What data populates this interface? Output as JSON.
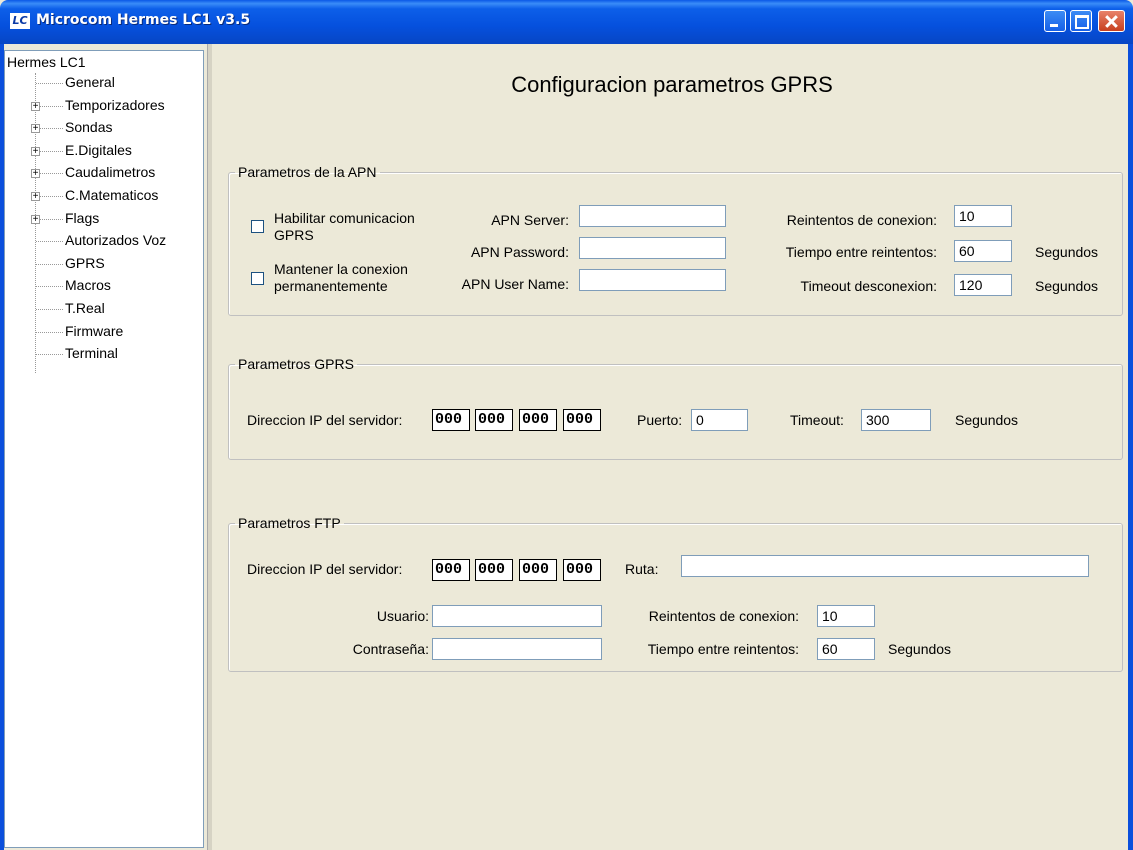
{
  "window": {
    "title": "Microcom Hermes LC1 v3.5",
    "logo_text": "LC"
  },
  "tree": {
    "root": "Hermes LC1",
    "items": [
      {
        "label": "General",
        "expandable": false
      },
      {
        "label": "Temporizadores",
        "expandable": true
      },
      {
        "label": "Sondas",
        "expandable": true
      },
      {
        "label": "E.Digitales",
        "expandable": true
      },
      {
        "label": "Caudalimetros",
        "expandable": true
      },
      {
        "label": "C.Matematicos",
        "expandable": true
      },
      {
        "label": "Flags",
        "expandable": true
      },
      {
        "label": "Autorizados Voz",
        "expandable": false
      },
      {
        "label": "GPRS",
        "expandable": false
      },
      {
        "label": "Macros",
        "expandable": false
      },
      {
        "label": "T.Real",
        "expandable": false
      },
      {
        "label": "Firmware",
        "expandable": false
      },
      {
        "label": "Terminal",
        "expandable": false
      }
    ],
    "expander_symbol": "+"
  },
  "main": {
    "title": "Configuracion parametros GPRS",
    "apn": {
      "legend": "Parametros de la APN",
      "enable_label_1": "Habilitar comunicacion",
      "enable_label_2": "GPRS",
      "keep_label_1": "Mantener la conexion",
      "keep_label_2": "permanentemente",
      "server_label": "APN Server:",
      "server_value": "",
      "password_label": "APN Password:",
      "password_value": "",
      "username_label": "APN User Name:",
      "username_value": "",
      "retries_label": "Reintentos de conexion:",
      "retries_value": "10",
      "interval_label": "Tiempo entre reintentos:",
      "interval_value": "60",
      "interval_unit": "Segundos",
      "timeout_label": "Timeout desconexion:",
      "timeout_value": "120",
      "timeout_unit": "Segundos"
    },
    "gprs": {
      "legend": "Parametros GPRS",
      "ip_label": "Direccion IP del servidor:",
      "ip": [
        "000",
        "000",
        "000",
        "000"
      ],
      "port_label": "Puerto:",
      "port_value": "0",
      "timeout_label": "Timeout:",
      "timeout_value": "300",
      "timeout_unit": "Segundos"
    },
    "ftp": {
      "legend": "Parametros FTP",
      "ip_label": "Direccion IP del servidor:",
      "ip": [
        "000",
        "000",
        "000",
        "000"
      ],
      "path_label": "Ruta:",
      "path_value": "",
      "user_label": "Usuario:",
      "user_value": "",
      "password_label": "Contraseña:",
      "password_value": "",
      "retries_label": "Reintentos de conexion:",
      "retries_value": "10",
      "interval_label": "Tiempo entre reintentos:",
      "interval_value": "60",
      "interval_unit": "Segundos"
    }
  }
}
